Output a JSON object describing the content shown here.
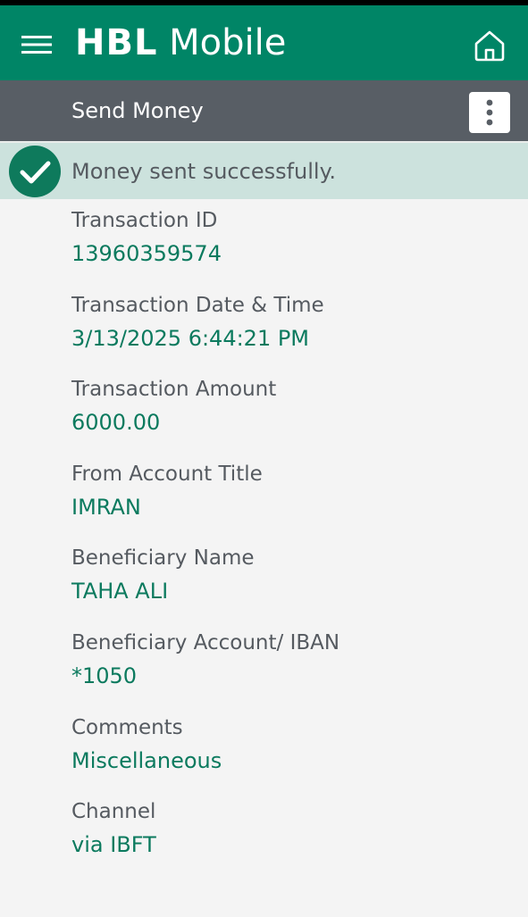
{
  "header": {
    "brand_bank": "HBL",
    "brand_app": "Mobile",
    "menu_icon": "hamburger-menu-icon",
    "home_icon": "home-icon"
  },
  "subheader": {
    "title": "Send Money",
    "more_icon": "kebab-menu-icon"
  },
  "colors": {
    "brand_green": "#008566",
    "subheader_gray": "#585e65",
    "success_banner": "#cce2dd",
    "value_green": "#0b7a5e",
    "label_gray": "#555a60"
  },
  "banner": {
    "icon": "check-circle-icon",
    "message": "Money sent successfully."
  },
  "details": [
    {
      "label": "Transaction ID",
      "value": "13960359574"
    },
    {
      "label": "Transaction Date & Time",
      "value": "3/13/2025 6:44:21 PM"
    },
    {
      "label": "Transaction Amount",
      "value": "6000.00"
    },
    {
      "label": "From Account Title",
      "value": "IMRAN"
    },
    {
      "label": "Beneficiary Name",
      "value": "TAHA ALI"
    },
    {
      "label": "Beneficiary Account/ IBAN",
      "value": "*1050"
    },
    {
      "label": "Comments",
      "value": "Miscellaneous"
    },
    {
      "label": "Channel",
      "value": "via IBFT"
    }
  ]
}
